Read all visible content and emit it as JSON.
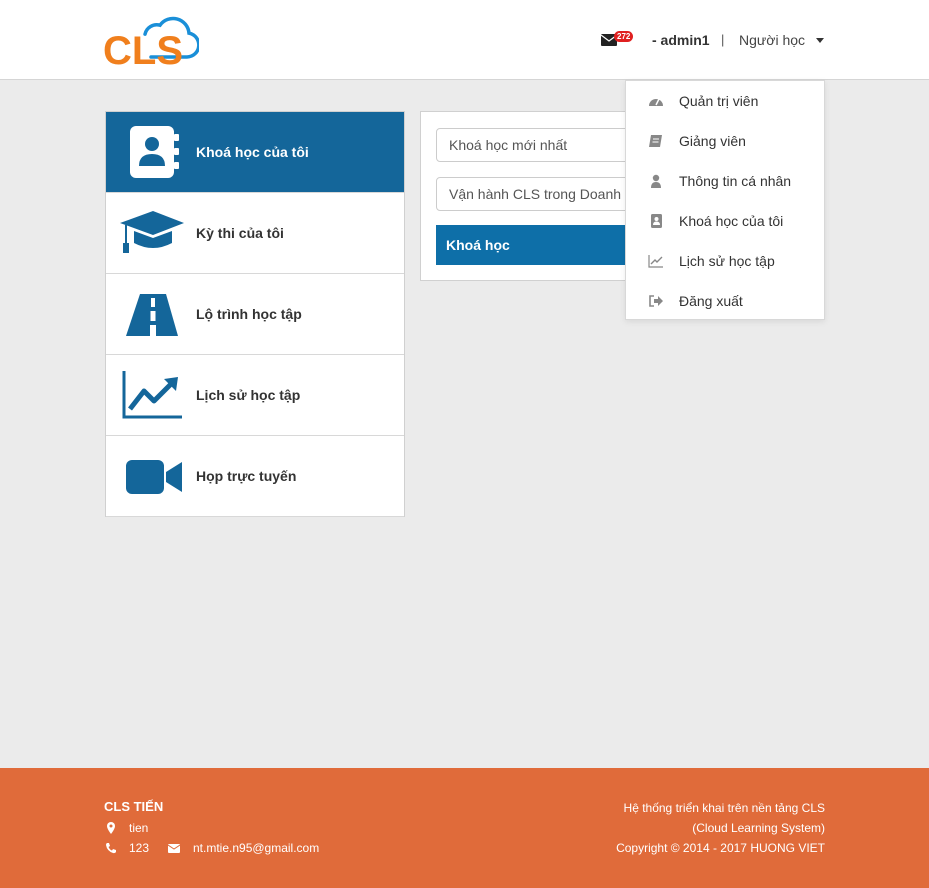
{
  "header": {
    "logo_text": "CLS",
    "mail_count": "272",
    "username": "- admin1",
    "separator": "|",
    "role": "Người học"
  },
  "sidebar": {
    "items": [
      {
        "label": "Khoá học của tôi",
        "icon": "address-book-icon",
        "active": true
      },
      {
        "label": "Kỳ thi của tôi",
        "icon": "graduation-cap-icon",
        "active": false
      },
      {
        "label": "Lộ trình học tập",
        "icon": "road-icon",
        "active": false
      },
      {
        "label": "Lịch sử học tập",
        "icon": "line-chart-icon",
        "active": false
      },
      {
        "label": "Họp trực tuyến",
        "icon": "video-camera-icon",
        "active": false
      }
    ]
  },
  "panel": {
    "field1": "Khoá học mới nhất",
    "field2": "Vận hành CLS trong Doanh Ng",
    "button": "Khoá học"
  },
  "dropdown": {
    "items": [
      {
        "label": "Quản trị viên",
        "icon": "dashboard-icon"
      },
      {
        "label": "Giảng viên",
        "icon": "book-icon"
      },
      {
        "label": "Thông tin cá nhân",
        "icon": "user-icon"
      },
      {
        "label": "Khoá học của tôi",
        "icon": "address-book-icon"
      },
      {
        "label": "Lịch sử học tập",
        "icon": "line-chart-icon"
      },
      {
        "label": "Đăng xuất",
        "icon": "sign-out-icon"
      }
    ]
  },
  "footer": {
    "title": "CLS TIẾN",
    "address": "tien",
    "phone": "123",
    "email": "nt.mtie.n95@gmail.com",
    "right_line1": "Hệ thống triển khai trên nền tảng CLS",
    "right_line2": "(Cloud Learning System)",
    "right_line3": "Copyright © 2014 - 2017 HUONG VIET"
  },
  "colors": {
    "primary": "#14669a",
    "brand_orange": "#f07f1d",
    "brand_blue": "#1a8fd8",
    "footer": "#e06b3a"
  }
}
